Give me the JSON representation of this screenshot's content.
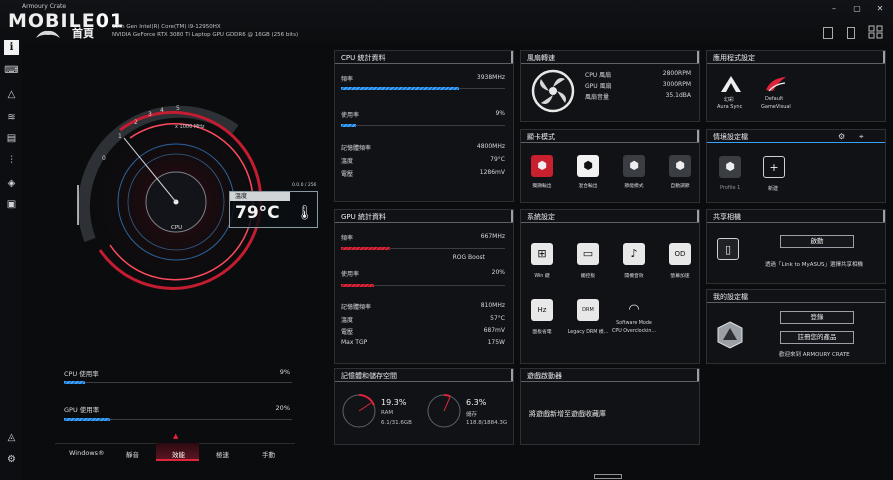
{
  "app": {
    "window_title": "Armoury Crate",
    "logo_text": "MOBILE",
    "logo_suffix": "01",
    "page_title": "首頁",
    "cpu_name": "12th Gen Intel(R) Core(TM) i9-12950HX",
    "gpu_name": "NVIDIA GeForce RTX 3080 Ti Laptop GPU GDDR6 @ 16GB (256 bits)"
  },
  "window_controls": [
    "minimize",
    "maximize",
    "close"
  ],
  "sidebar": {
    "items": [
      {
        "icon": "info-icon",
        "glyph": "i"
      },
      {
        "icon": "device-icon",
        "glyph": "⌨"
      },
      {
        "icon": "aura-icon",
        "glyph": "△"
      },
      {
        "icon": "armoury-icon",
        "glyph": "≋"
      },
      {
        "icon": "scenario-icon",
        "glyph": "▤"
      },
      {
        "icon": "tuning-icon",
        "glyph": "⫶"
      },
      {
        "icon": "tag-icon",
        "glyph": "◈"
      },
      {
        "icon": "media-icon",
        "glyph": "▣"
      },
      {
        "icon": "notification-icon",
        "glyph": "◬"
      },
      {
        "icon": "settings-icon",
        "glyph": "⚙"
      }
    ]
  },
  "gauge": {
    "ticks": [
      "0",
      "1",
      "2",
      "3",
      "4",
      "5"
    ],
    "unit": "x 1000 MHz",
    "readout": "0.0.0 / 256",
    "temp_label": "溫度",
    "temp_value": "79°C",
    "cpu_label": "CPU"
  },
  "usage": {
    "cpu_label": "CPU 使用率",
    "cpu_value": "9%",
    "cpu_fraction": 0.09,
    "gpu_label": "GPU 使用率",
    "gpu_value": "20%",
    "gpu_fraction": 0.2
  },
  "modes": {
    "items": [
      "Windows®",
      "靜音",
      "效能",
      "極速",
      "手動"
    ],
    "active": "效能"
  },
  "cpu_panel": {
    "title": "CPU 統計資料",
    "freq_label": "頻率",
    "freq_value": "3938MHz",
    "freq_fraction": 0.72,
    "usage_label": "使用率",
    "usage_value": "9%",
    "usage_fraction": 0.09,
    "mem_freq_label": "記憶體頻率",
    "mem_freq_value": "4800MHz",
    "temp_label": "溫度",
    "temp_value": "79°C",
    "voltage_label": "電壓",
    "voltage_value": "1286mV"
  },
  "gpu_panel": {
    "title": "GPU 統計資料",
    "freq_label": "頻率",
    "freq_value": "667MHz",
    "freq_fraction": 0.3,
    "boost_label": "ROG Boost",
    "usage_label": "使用率",
    "usage_value": "20%",
    "usage_fraction": 0.2,
    "mem_freq_label": "記憶體頻率",
    "mem_freq_value": "810MHz",
    "temp_label": "溫度",
    "temp_value": "57°C",
    "voltage_label": "電壓",
    "voltage_value": "687mV",
    "tgp_label": "Max TGP",
    "tgp_value": "175W"
  },
  "memory_panel": {
    "title": "記憶體和儲存空間",
    "ram_percent": "19.3%",
    "ram_fraction": 0.193,
    "ram_label": "RAM",
    "ram_detail": "6.1/31.6GB",
    "storage_percent": "6.3%",
    "storage_fraction": 0.063,
    "storage_label": "儲存",
    "storage_detail": "118.8/1884.3G"
  },
  "fan_panel": {
    "title": "風扇轉速",
    "cpu_fan_label": "CPU 風扇",
    "cpu_fan_value": "2800RPM",
    "gpu_fan_label": "GPU 風扇",
    "gpu_fan_value": "3000RPM",
    "noise_label": "風扇音量",
    "noise_value": "35.1dBA"
  },
  "gpu_mode_panel": {
    "title": "顯卡模式",
    "items": [
      {
        "label": "獨顯輸出",
        "icon": "ultimate-mode-icon",
        "color": "#c8202f"
      },
      {
        "label": "混合輸出",
        "icon": "standard-mode-icon",
        "color": "#f2f2f2"
      },
      {
        "label": "節能模式",
        "icon": "eco-mode-icon",
        "color": "#3a3d42"
      },
      {
        "label": "自動調節",
        "icon": "optimized-mode-icon",
        "color": "#3a3d42"
      }
    ]
  },
  "system_panel": {
    "title": "系統設定",
    "items": [
      {
        "label": "Win 鍵",
        "icon": "windows-key-icon",
        "glyph": "⊞"
      },
      {
        "label": "觸控板",
        "icon": "touchpad-icon",
        "glyph": "▭"
      },
      {
        "label": "開機音效",
        "icon": "boot-sound-icon",
        "glyph": "♪"
      },
      {
        "label": "螢幕加速",
        "icon": "panel-overdrive-icon",
        "glyph": "OD"
      },
      {
        "label": "面板省電",
        "icon": "panel-power-icon",
        "glyph": "Hz"
      },
      {
        "label": "Legacy DRM 模...",
        "icon": "legacy-drm-icon",
        "glyph": "DRM"
      },
      {
        "label": "Software Mode",
        "icon": "software-mode-icon",
        "glyph": "◠"
      },
      {
        "label": "CPU Overclockin...",
        "icon": "cpu-overclock-icon",
        "glyph": ""
      }
    ]
  },
  "game_panel": {
    "title": "遊戲啟動器",
    "text": "將遊戲新增至遊戲收藏庫"
  },
  "apps_panel": {
    "title": "應用程式設定",
    "items": [
      {
        "label": "Aura Sync",
        "sub": "幻彩",
        "icon": "aura-sync-icon"
      },
      {
        "label": "GameVisual",
        "sub": "Default",
        "icon": "gamevisual-icon"
      }
    ]
  },
  "scenario_panel": {
    "title": "情境設定檔",
    "profile_label": "Profile 1",
    "new_label": "新建"
  },
  "share_panel": {
    "title": "共享相機",
    "button": "啟動",
    "text": "透過「Link to MyASUS」選擇共享相機"
  },
  "profile_panel": {
    "title": "我的設定檔",
    "login": "登錄",
    "register": "註冊您的產品",
    "welcome": "歡迎來到 ARMOURY CRATE"
  },
  "colors": {
    "accent_red": "#e0253b",
    "accent_blue": "#3aa1ff"
  }
}
